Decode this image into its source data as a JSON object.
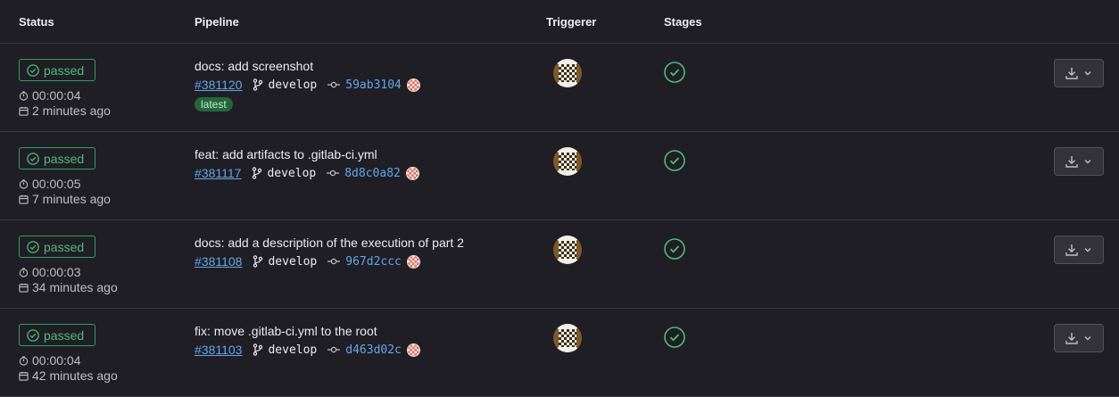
{
  "headers": {
    "status": "Status",
    "pipeline": "Pipeline",
    "triggerer": "Triggerer",
    "stages": "Stages"
  },
  "colors": {
    "background": "#1f1e24",
    "success": "#52b87a",
    "link": "#63a6e9",
    "latest_badge_bg": "#24663b"
  },
  "rows": [
    {
      "status": "passed",
      "duration": "00:00:04",
      "created": "2 minutes ago",
      "title": "docs: add screenshot",
      "id": "#381120",
      "branch": "develop",
      "commit": "59ab3104",
      "badge": "latest"
    },
    {
      "status": "passed",
      "duration": "00:00:05",
      "created": "7 minutes ago",
      "title": "feat: add artifacts to .gitlab-ci.yml",
      "id": "#381117",
      "branch": "develop",
      "commit": "8d8c0a82"
    },
    {
      "status": "passed",
      "duration": "00:00:03",
      "created": "34 minutes ago",
      "title": "docs: add a description of the execution of part 2",
      "id": "#381108",
      "branch": "develop",
      "commit": "967d2ccc"
    },
    {
      "status": "passed",
      "duration": "00:00:04",
      "created": "42 minutes ago",
      "title": "fix: move .gitlab-ci.yml to the root",
      "id": "#381103",
      "branch": "develop",
      "commit": "d463d02c"
    }
  ],
  "icons": {
    "status": "check-circle-icon",
    "duration": "timer-icon",
    "created": "calendar-icon",
    "branch": "branch-icon",
    "commit": "commit-icon",
    "stage": "stage-success-icon",
    "download": "download-icon",
    "dropdown": "chevron-down-icon"
  }
}
